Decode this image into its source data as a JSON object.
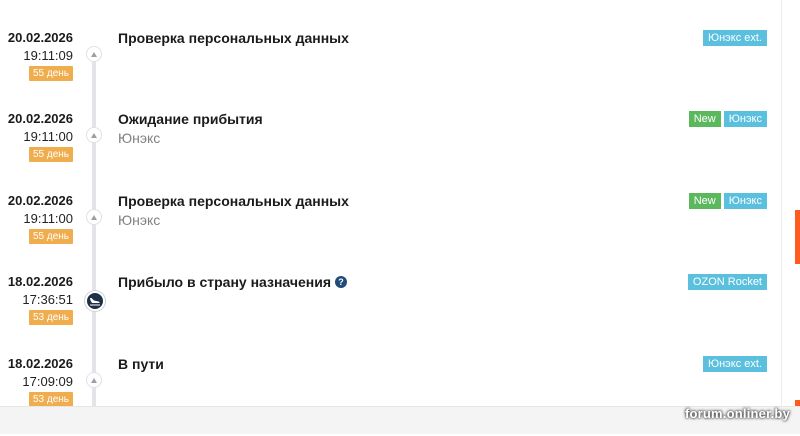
{
  "events": [
    {
      "date": "20.02.2026",
      "time": "19:11:09",
      "days": "55 день",
      "title": "Проверка персональных данных",
      "subtitle": "",
      "tags": [
        {
          "label": "Юнэкс ext.",
          "color": "#5bc0de"
        }
      ],
      "icon": "up-arrow-icon",
      "help": ""
    },
    {
      "date": "20.02.2026",
      "time": "19:11:00",
      "days": "55 день",
      "title": "Ожидание прибытия",
      "subtitle": "Юнэкс",
      "tags": [
        {
          "label": "New",
          "color": "#5cb85c"
        },
        {
          "label": "Юнэкс",
          "color": "#5bc0de"
        }
      ],
      "icon": "up-arrow-icon",
      "help": ""
    },
    {
      "date": "20.02.2026",
      "time": "19:11:00",
      "days": "55 день",
      "title": "Проверка персональных данных",
      "subtitle": "Юнэкс",
      "tags": [
        {
          "label": "New",
          "color": "#5cb85c"
        },
        {
          "label": "Юнэкс",
          "color": "#5bc0de"
        }
      ],
      "icon": "up-arrow-icon",
      "help": ""
    },
    {
      "date": "18.02.2026",
      "time": "17:36:51",
      "days": "53 день",
      "title": "Прибыло в страну назначения",
      "subtitle": "",
      "tags": [
        {
          "label": "OZON Rocket",
          "color": "#5bc0de"
        }
      ],
      "icon": "plane-landing-icon",
      "help": "?"
    },
    {
      "date": "18.02.2026",
      "time": "17:09:09",
      "days": "53 день",
      "title": "В пути",
      "subtitle": "",
      "tags": [
        {
          "label": "Юнэкс ext.",
          "color": "#5bc0de"
        }
      ],
      "icon": "up-arrow-icon",
      "help": ""
    }
  ],
  "watermark": "forum.onliner.by",
  "colors": {
    "days_badge": "#f0ad4e",
    "tag_blue": "#5bc0de",
    "tag_green": "#5cb85c",
    "accent_edge": "#ff5a1f",
    "plane_dot": "#1f2f46"
  }
}
